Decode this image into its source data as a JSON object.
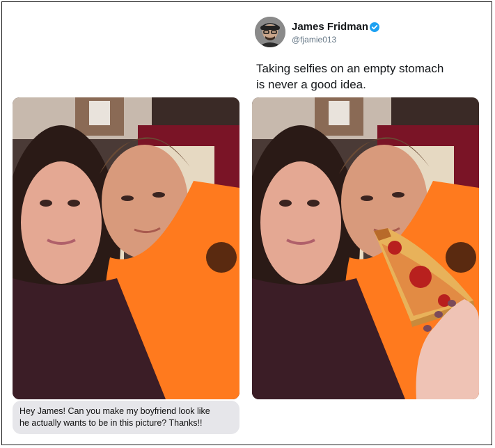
{
  "tweet": {
    "display_name": "James Fridman",
    "handle": "@fjamie013",
    "text_line1": "Taking selfies on an empty stomach",
    "text_line2": "is never a good idea.",
    "verified": true,
    "verified_color": "#1da1f2"
  },
  "photos": {
    "original_alt": "original selfie",
    "edited_alt": "edited selfie with pizza slice"
  },
  "message": {
    "line1": "Hey James! Can you make my boyfriend look like",
    "line2": "he actually wants to be in this picture? Thanks!!"
  },
  "colors": {
    "shirt": "#ff7a1e",
    "bubble": "#e6e6ea",
    "sweater": "#3b1d26"
  }
}
